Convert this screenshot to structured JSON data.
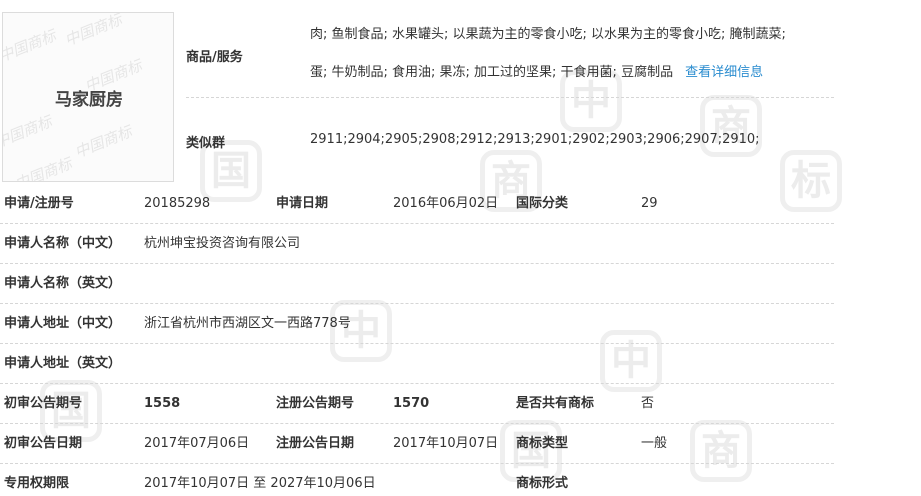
{
  "logo": {
    "name": "马家厨房",
    "watermark_text": "中国商标"
  },
  "goods_services": {
    "label": "商品/服务",
    "line1": "肉; 鱼制食品; 水果罐头; 以果蔬为主的零食小吃; 以水果为主的零食小吃; 腌制蔬菜;",
    "line2": "蛋; 牛奶制品; 食用油; 果冻; 加工过的坚果; 干食用菌; 豆腐制品",
    "detail_link": "查看详细信息"
  },
  "similar_groups": {
    "label": "类似群",
    "value": "2911;2904;2905;2908;2912;2913;2901;2902;2903;2906;2907;2910;"
  },
  "rows": {
    "reg_no_label": "申请/注册号",
    "reg_no": "20185298",
    "apply_date_label": "申请日期",
    "apply_date": "2016年06月02日",
    "intl_class_label": "国际分类",
    "intl_class": "29",
    "applicant_cn_label": "申请人名称（中文）",
    "applicant_cn": "杭州坤宝投资咨询有限公司",
    "applicant_en_label": "申请人名称（英文）",
    "applicant_en": "",
    "address_cn_label": "申请人地址（中文）",
    "address_cn": "浙江省杭州市西湖区文一西路778号",
    "address_en_label": "申请人地址（英文）",
    "address_en": "",
    "prelim_issue_label": "初审公告期号",
    "prelim_issue": "1558",
    "reg_issue_label": "注册公告期号",
    "reg_issue": "1570",
    "shared_label": "是否共有商标",
    "shared": "否",
    "prelim_date_label": "初审公告日期",
    "prelim_date": "2017年07月06日",
    "reg_date_label": "注册公告日期",
    "reg_date": "2017年10月07日",
    "mark_type_label": "商标类型",
    "mark_type": "一般",
    "exclusive_label": "专用权期限",
    "exclusive_period": "2017年10月07日 至 2027年10月06日",
    "mark_form_label": "商标形式",
    "mark_form": ""
  }
}
